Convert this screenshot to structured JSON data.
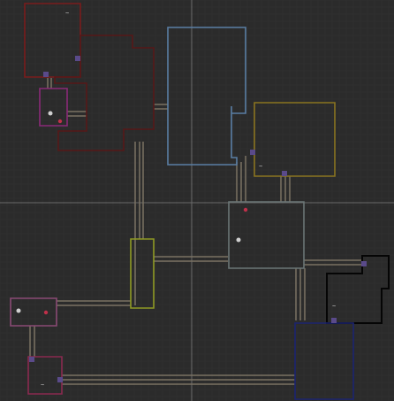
{
  "title": "",
  "colors": {
    "background": "#2b2b2b",
    "grid": "#353535",
    "axis": "#6a6a6a",
    "corridor": "#7b7263",
    "room_red": "#7a1c1c",
    "room_red_dark": "#561818",
    "room_magenta": "#8a2a78",
    "room_blue": "#5a7ea4",
    "room_gold": "#8a7420",
    "room_gray": "#6b7676",
    "room_olive": "#8f9a24",
    "room_black": "#050505",
    "room_navy": "#1c2470",
    "room_pink": "#8a4a74",
    "room_crimson": "#8a2a50",
    "door": "#5a4a8a",
    "marker_white": "#d0d0d0",
    "marker_red": "#c0304a"
  },
  "rooms": [
    {
      "name": "room-red-northwest"
    },
    {
      "name": "room-red-wing"
    },
    {
      "name": "room-magenta-small"
    },
    {
      "name": "room-blue-central"
    },
    {
      "name": "room-gold-east"
    },
    {
      "name": "room-gray-hub"
    },
    {
      "name": "room-olive-corridor"
    },
    {
      "name": "room-black-east"
    },
    {
      "name": "room-navy-southeast"
    },
    {
      "name": "room-pink-southwest"
    },
    {
      "name": "room-crimson-southwest"
    }
  ],
  "icons": [
    "door-marker-icon",
    "player-marker-icon",
    "enemy-marker-icon",
    "tilde-glyph-icon"
  ],
  "glyph": "~"
}
